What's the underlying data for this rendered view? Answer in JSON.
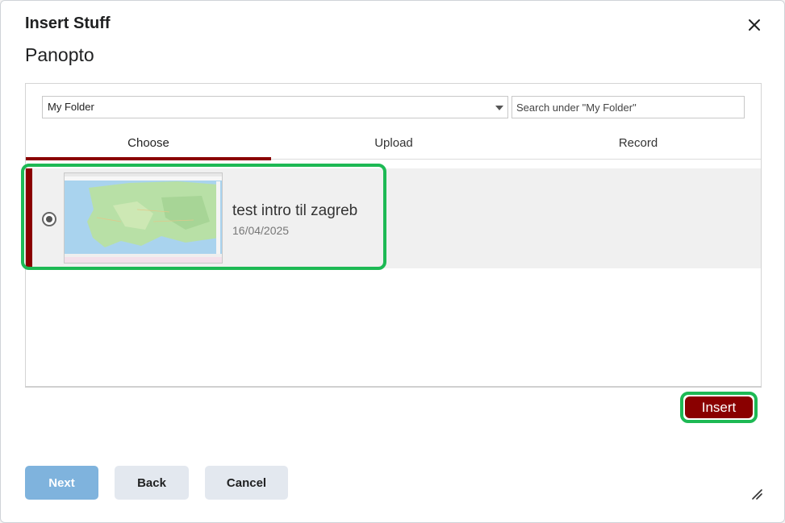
{
  "dialog": {
    "title": "Insert Stuff",
    "subtitle": "Panopto"
  },
  "panopto": {
    "folder_selected": "My Folder",
    "search_placeholder": "Search under \"My Folder\"",
    "tabs": [
      {
        "label": "Choose",
        "active": true
      },
      {
        "label": "Upload",
        "active": false
      },
      {
        "label": "Record",
        "active": false
      }
    ],
    "sessions": [
      {
        "title": "test intro til zagreb",
        "date": "16/04/2025",
        "selected": true
      }
    ],
    "insert_label": "Insert"
  },
  "footer": {
    "next_label": "Next",
    "back_label": "Back",
    "cancel_label": "Cancel"
  },
  "colors": {
    "accent": "#8a0000",
    "highlight": "#1db954",
    "next_button": "#7fb3dd",
    "secondary_button": "#e3e8ef"
  }
}
